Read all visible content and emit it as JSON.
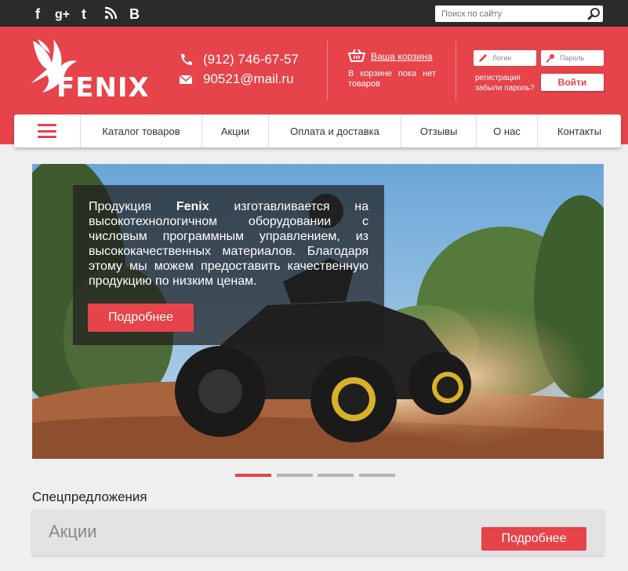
{
  "social": {
    "icons": [
      "facebook-icon",
      "google-plus-icon",
      "twitter-icon",
      "rss-icon",
      "vk-icon"
    ],
    "labels": [
      "f",
      "g+",
      "t",
      "rss",
      "B"
    ]
  },
  "search": {
    "placeholder": "Поиск по сайту",
    "icon": "search-icon"
  },
  "header": {
    "brand": "FENIX",
    "phone": "(912) 746-67-57",
    "email": "90521@mail.ru",
    "cart_link": "Ваша корзина",
    "cart_note": "В корзине пока нет товаров",
    "login_placeholder": "Логин",
    "password_placeholder": "Пароль",
    "register_link": "регистрация",
    "forgot_link": "забыли пароль?",
    "login_button": "Войти"
  },
  "nav": {
    "menu_icon": "hamburger-icon",
    "items": [
      "Каталог товаров",
      "Акции",
      "Оплата и доставка",
      "Отзывы",
      "О нас",
      "Контакты"
    ]
  },
  "hero": {
    "text_before": "Продукция ",
    "brand": "Fenix",
    "text_after": " изготавливается на высокотехнологичном оборудовании с числовым программным управлением, из высококачественных материалов. Благодаря этому мы можем предоставить качественную продукцию по низким ценам.",
    "button": "Подробнее"
  },
  "slider": {
    "slides": 4,
    "active_index": 0
  },
  "specials": {
    "title": "Спецпредложения",
    "card_title": "Акции",
    "card_button": "Подробнее"
  },
  "colors": {
    "accent": "#e6434a",
    "topbar": "#2b2b2b",
    "background": "#efefef"
  }
}
